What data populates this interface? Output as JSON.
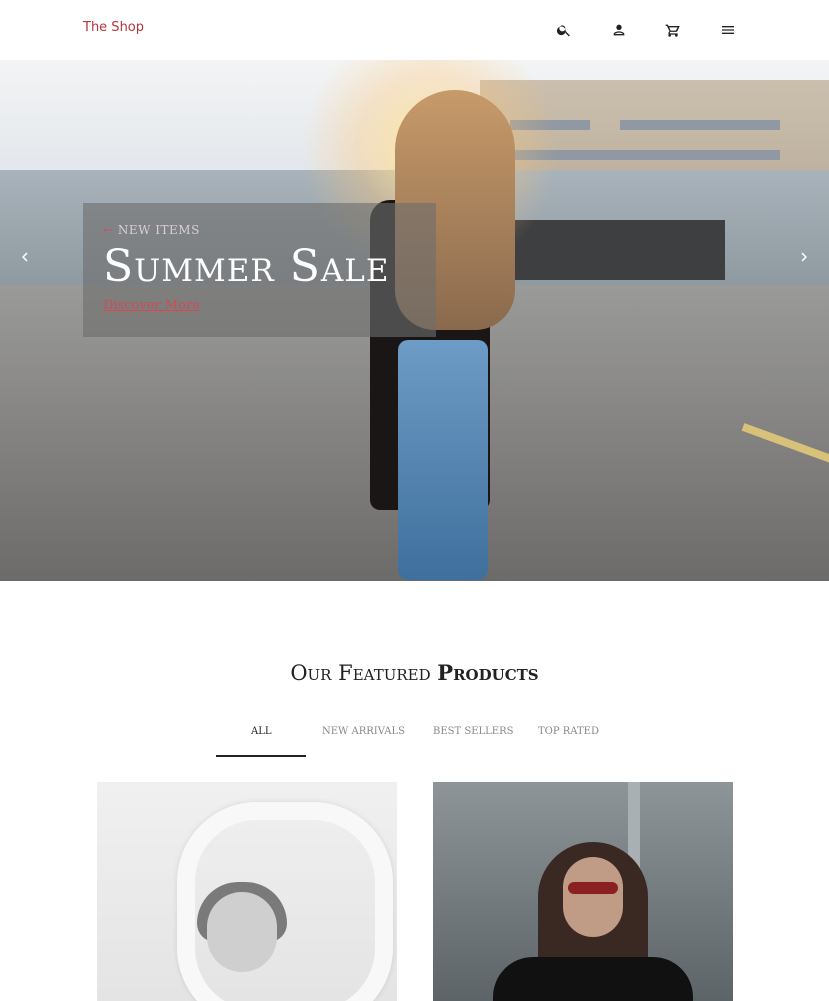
{
  "header": {
    "brand": "The Shop",
    "icons": [
      "search-icon",
      "account-icon",
      "cart-icon",
      "menu-icon"
    ]
  },
  "hero": {
    "kicker_arrow": "←",
    "kicker": "NEW ITEMS",
    "title": "Summer Sale",
    "cta": "Discover More"
  },
  "featured": {
    "title_light": "Our Featured",
    "title_bold": "Products",
    "tabs": [
      {
        "label": "ALL",
        "active": true
      },
      {
        "label": "NEW ARRIVALS",
        "active": false
      },
      {
        "label": "BEST SELLERS",
        "active": false
      },
      {
        "label": "TOP RATED",
        "active": false
      }
    ]
  },
  "colors": {
    "brand": "#b5343c",
    "accent": "#d14b55"
  }
}
